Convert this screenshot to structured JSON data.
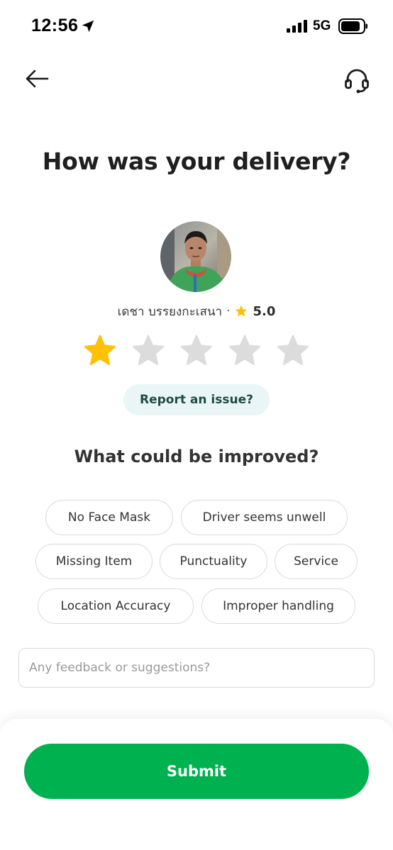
{
  "status_bar": {
    "time": "12:56",
    "network": "5G"
  },
  "header": {
    "back_icon": "arrow-left-icon",
    "support_icon": "headset-icon"
  },
  "title": "How was your delivery?",
  "driver": {
    "name": "เดชา บรรยงกะเสนา",
    "separator": "·",
    "rating": "5.0"
  },
  "rating": {
    "selected": 1,
    "max": 5,
    "filled_color": "#FFC107",
    "empty_color": "#DCDCDC"
  },
  "report_label": "Report an issue?",
  "improve_title": "What could be improved?",
  "chips": [
    "No Face Mask",
    "Driver seems unwell",
    "Missing Item",
    "Punctuality",
    "Service",
    "Location Accuracy",
    "Improper handling"
  ],
  "feedback": {
    "placeholder": "Any feedback or suggestions?",
    "value": ""
  },
  "submit_label": "Submit",
  "colors": {
    "brand_green": "#00B14F",
    "report_bg": "#EAF6F5",
    "report_text": "#1C4C45"
  }
}
